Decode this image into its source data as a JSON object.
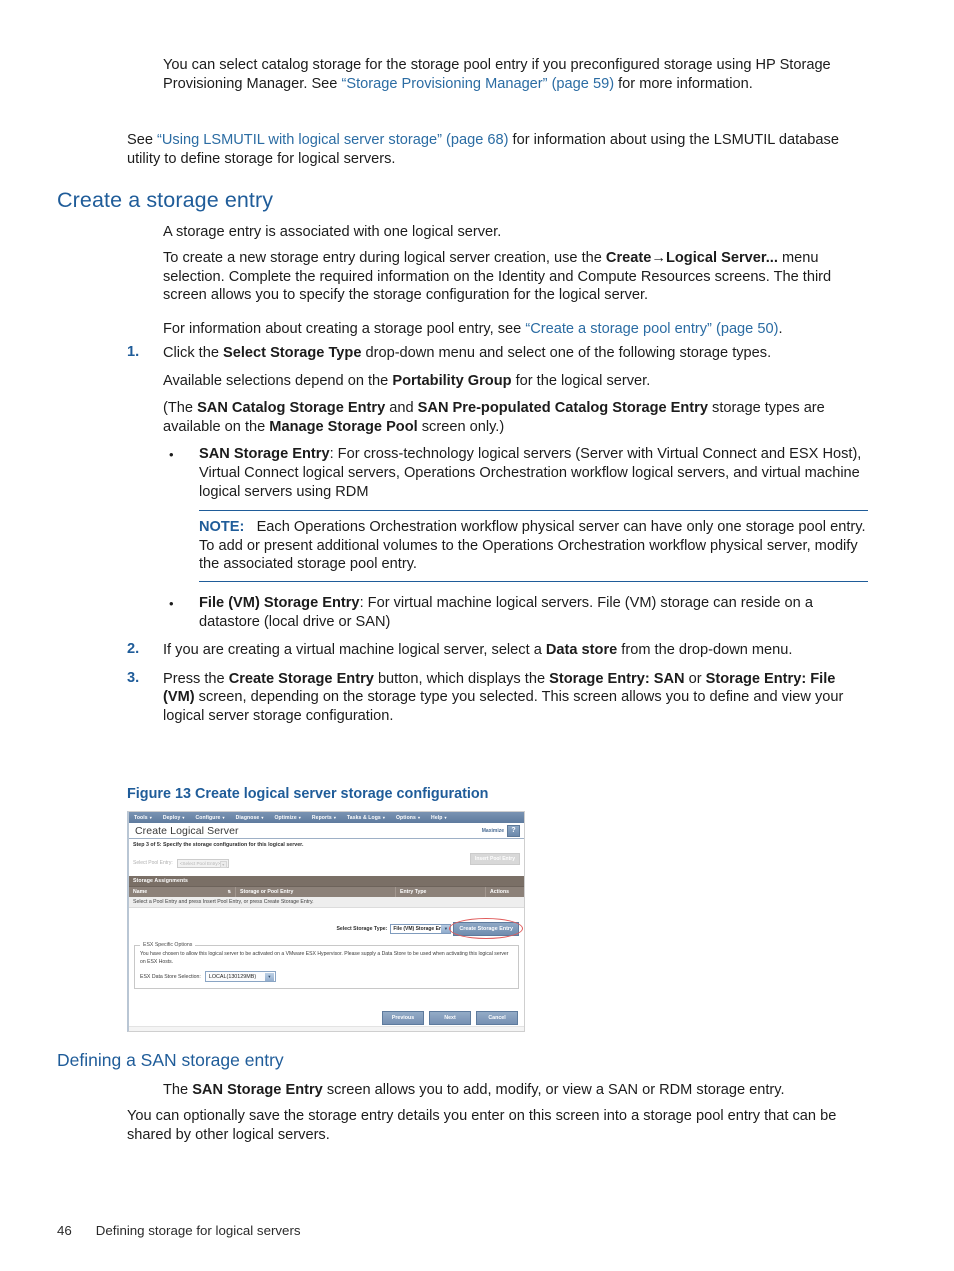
{
  "page": {
    "footer_number": "46",
    "footer_title": "Defining storage for logical servers"
  },
  "intro": {
    "para1_a": "You can select catalog storage for the storage pool entry if you preconfigured storage using HP Storage Provisioning Manager. See ",
    "para1_link": "“Storage Provisioning Manager” (page 59)",
    "para1_b": " for more information.",
    "para2_a": "See ",
    "para2_link": "“Using LSMUTIL with logical server storage” (page 68)",
    "para2_b": " for information about using the LSMUTIL database utility to define storage for logical servers."
  },
  "section": {
    "heading": "Create a storage entry",
    "para1": "A storage entry is associated with one logical server.",
    "para2_a": "To create a new storage entry during logical server creation, use the ",
    "para2_b1": "Create",
    "para2_arrow": "→",
    "para2_b2": "Logical Server...",
    "para2_c": " menu selection. Complete the required information on the Identity and Compute Resources screens. The third screen allows you to specify the storage configuration for the logical server.",
    "para3_a": "For information about creating a storage pool entry, see ",
    "para3_link": "“Create a storage pool entry” (page 50)",
    "para3_b": "."
  },
  "steps": [
    {
      "num": "1.",
      "p1_a": "Click the ",
      "p1_b": "Select Storage Type",
      "p1_c": " drop-down menu and select one of the following storage types.",
      "p2_a": "Available selections depend on the ",
      "p2_b": "Portability Group",
      "p2_c": " for the logical server.",
      "p3_a": "(The ",
      "p3_b1": "SAN Catalog Storage Entry",
      "p3_mid": " and ",
      "p3_b2": "SAN Pre-populated Catalog Storage Entry",
      "p3_c": " storage types are available on the ",
      "p3_b3": "Manage Storage Pool",
      "p3_d": " screen only.)",
      "bullet1_b": "SAN Storage Entry",
      "bullet1_t": ": For cross-technology logical servers (Server with Virtual Connect and ESX Host), Virtual Connect logical servers, Operations Orchestration workflow logical servers, and virtual machine logical servers using RDM",
      "note_label": "NOTE:",
      "note_text": "Each Operations Orchestration workflow physical server can have only one storage pool entry. To add or present additional volumes to the Operations Orchestration workflow physical server, modify the associated storage pool entry.",
      "bullet2_b": "File (VM) Storage Entry",
      "bullet2_t": ": For virtual machine logical servers. File (VM) storage can reside on a datastore (local drive or SAN)"
    },
    {
      "num": "2.",
      "p1_a": "If you are creating a virtual machine logical server, select a ",
      "p1_b": "Data store",
      "p1_c": " from the drop-down menu."
    },
    {
      "num": "3.",
      "p1_a": "Press the ",
      "p1_b1": "Create Storage Entry",
      "p1_mid": " button, which displays the ",
      "p1_b2": "Storage Entry: SAN",
      "p1_or": " or ",
      "p1_b3": "Storage Entry: File (VM)",
      "p1_c": " screen, depending on the storage type you selected. This screen allows you to define and view your logical server storage configuration."
    }
  ],
  "figure": {
    "caption": "Figure 13 Create logical server storage configuration",
    "app": {
      "menubar": [
        {
          "label": "Tools",
          "caret": "▾"
        },
        {
          "label": "Deploy",
          "caret": "▾"
        },
        {
          "label": "Configure",
          "caret": "▾"
        },
        {
          "label": "Diagnose",
          "caret": "▾"
        },
        {
          "label": "Optimize",
          "caret": "▾"
        },
        {
          "label": "Reports",
          "caret": "▾"
        },
        {
          "label": "Tasks & Logs",
          "caret": "▾"
        },
        {
          "label": "Options",
          "caret": "▾"
        },
        {
          "label": "Help",
          "caret": "▾"
        }
      ],
      "title": "Create Logical Server",
      "maximize_label": "Maximize",
      "help_label": "?",
      "step_text": "Step 3 of 5: Specify the storage configuration for this logical server.",
      "select_pool_label": "Select Pool Entry:",
      "select_pool_value": "<Select Pool Entry>",
      "select_pool_caret": "▾",
      "insert_pool_button": "Insert Pool Entry",
      "table": {
        "section_title": "Storage Assignments",
        "columns": [
          "Name",
          "Storage or Pool Entry",
          "Entry Type",
          "Actions"
        ],
        "sort_indicator": "⇅",
        "empty_message": "Select a Pool Entry and press Insert Pool Entry, or press Create Storage Entry."
      },
      "select_storage_type_label": "Select Storage Type:",
      "select_storage_type_value": "File (VM) Storage Entry",
      "select_storage_type_caret": "▾",
      "create_storage_entry_button": "Create Storage Entry",
      "esx": {
        "legend": "ESX Specific Options",
        "description": "You have chosen to allow this logical server to be activated on a VMware ESX Hypervisor. Please supply a Data Store to be used when activating this logical server on ESX Hosts.",
        "datastore_label": "ESX Data Store Selection:",
        "datastore_value": "LOCAL(130129MB)",
        "datastore_caret": "▾"
      },
      "buttons": [
        "Previous",
        "Next",
        "Cancel"
      ],
      "accent_color": "#6f8cae",
      "highlight_color": "#e05b5b"
    }
  },
  "subsection": {
    "heading": "Defining a SAN storage entry",
    "para1_a": "The ",
    "para1_b": "SAN Storage Entry",
    "para1_c": " screen allows you to add, modify, or view a SAN or RDM storage entry.",
    "para2": "You can optionally save the storage entry details you enter on this screen into a storage pool entry that can be shared by other logical servers."
  }
}
